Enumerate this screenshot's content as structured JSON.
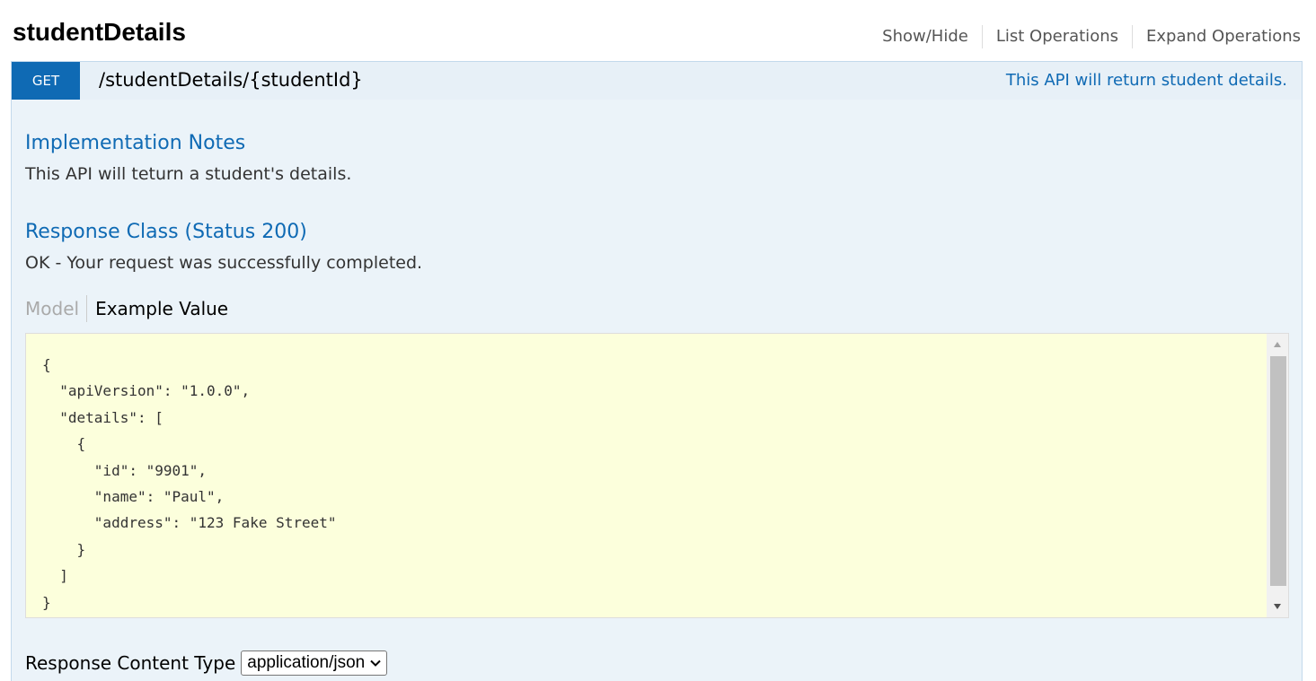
{
  "resource": {
    "title": "studentDetails",
    "links": [
      "Show/Hide",
      "List Operations",
      "Expand Operations"
    ]
  },
  "operation": {
    "method": "GET",
    "path": "/studentDetails/{studentId}",
    "summary": "This API will return student details."
  },
  "implementation_notes": {
    "heading": "Implementation Notes",
    "text": "This API will teturn a student's details."
  },
  "response_class": {
    "heading": "Response Class (Status 200)",
    "text": "OK - Your request was successfully completed."
  },
  "model_tabs": {
    "model_label": "Model",
    "example_label": "Example Value"
  },
  "example_json": "{\n  \"apiVersion\": \"1.0.0\",\n  \"details\": [\n    {\n      \"id\": \"9901\",\n      \"name\": \"Paul\",\n      \"address\": \"123 Fake Street\"\n    }\n  ]\n}",
  "response_content_type": {
    "label": "Response Content Type",
    "selected": "application/json"
  },
  "colors": {
    "accent": "#0f6ab4",
    "panel_bg": "#ebf3f9",
    "code_bg": "#fcffdc"
  }
}
